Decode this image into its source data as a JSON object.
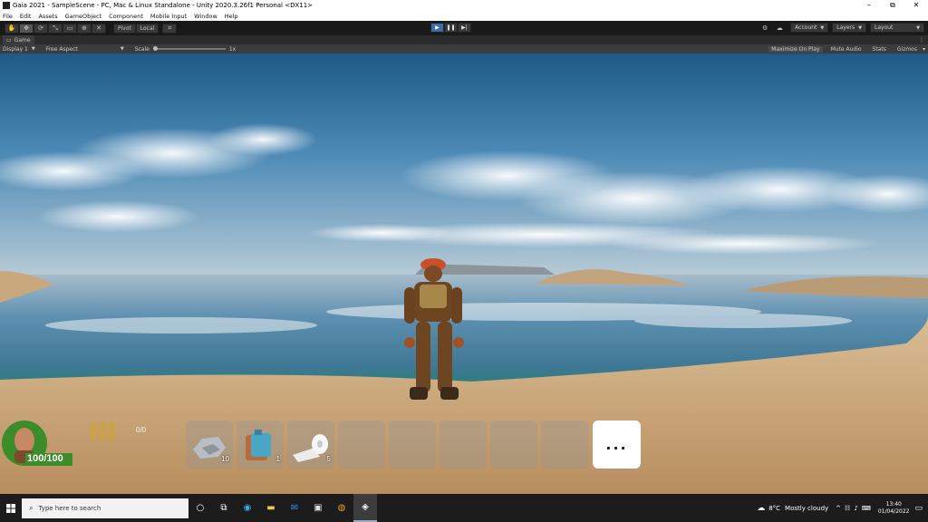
{
  "titlebar": {
    "title": "Gaia 2021 - SampleScene - PC, Mac & Linux Standalone - Unity 2020.3.26f1 Personal <DX11>",
    "minimize": "–",
    "maximize": "⧉",
    "close": "✕"
  },
  "menubar": [
    "File",
    "Edit",
    "Assets",
    "GameObject",
    "Component",
    "Mobile Input",
    "Window",
    "Help"
  ],
  "toolbar": {
    "tools": [
      "✋",
      "✥",
      "⟳",
      "⤡",
      "▭",
      "⊕",
      "✕"
    ],
    "pivot_label": "Pivot",
    "local_label": "Local",
    "account_label": "Account",
    "layers_label": "Layers",
    "layout_label": "Layout"
  },
  "game_tab": {
    "label": "Game"
  },
  "game_options": {
    "display": "Display 1",
    "aspect": "Free Aspect",
    "scale_label": "Scale",
    "scale_value": "1x",
    "maximize_on_play": "Maximize On Play",
    "mute_audio": "Mute Audio",
    "stats": "Stats",
    "gizmos": "Gizmos"
  },
  "hud": {
    "health_text": "100/100",
    "ammo_text": "0/0",
    "slots": [
      {
        "icon": "stone-icon",
        "count": "10"
      },
      {
        "icon": "water-bottle-icon",
        "count": "1"
      },
      {
        "icon": "toilet-paper-icon",
        "count": "5"
      },
      {
        "icon": "",
        "count": ""
      },
      {
        "icon": "",
        "count": ""
      },
      {
        "icon": "",
        "count": ""
      },
      {
        "icon": "",
        "count": ""
      },
      {
        "icon": "",
        "count": ""
      }
    ],
    "more_label": "..."
  },
  "taskbar": {
    "search_placeholder": "Type here to search",
    "weather_temp": "8°C",
    "weather_desc": "Mostly cloudy",
    "time": "13:40",
    "date": "01/04/2022"
  },
  "colors": {
    "play_active": "#3a6ea5",
    "health_green": "#3c8c2c",
    "sky_top": "#1f5a86",
    "sea": "#4a80a4",
    "sand": "#d4b48a"
  }
}
